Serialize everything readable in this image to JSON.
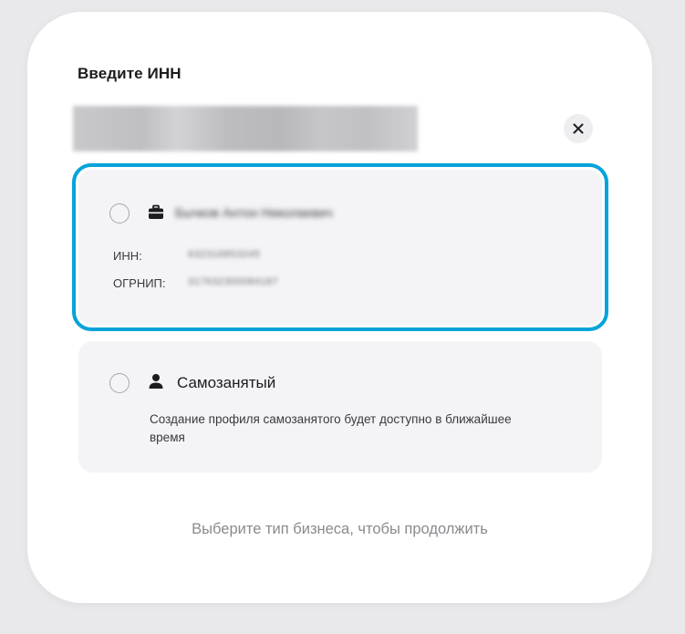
{
  "modal": {
    "title": "Введите ИНН",
    "inn_input": {
      "value": "",
      "placeholder": ""
    },
    "close_icon": "close-icon"
  },
  "options": {
    "ip": {
      "selected": true,
      "icon": "briefcase-icon",
      "name": "Бычков Антон Николаевич",
      "inn_label": "ИНН:",
      "inn_value": "632316853245",
      "ogrnip_label": "ОГРНИП:",
      "ogrnip_value": "317632300084187"
    },
    "self_employed": {
      "selected": false,
      "icon": "person-icon",
      "title": "Самозанятый",
      "description": "Создание профиля самозанятого будет доступно в ближайшее время"
    }
  },
  "hint": "Выберите тип бизнеса, чтобы продолжить",
  "colors": {
    "accent": "#06a3db",
    "card_bg": "#f4f4f6",
    "hint_text": "#8a8a8f"
  }
}
